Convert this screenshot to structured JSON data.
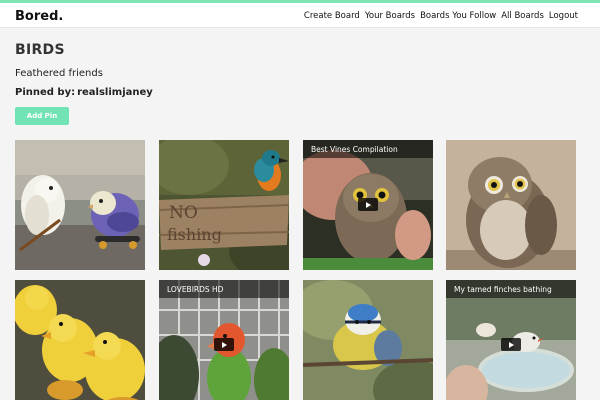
{
  "header": {
    "brand": "Bored.",
    "nav": [
      "Create Board",
      "Your Boards",
      "Boards You Follow",
      "All Boards",
      "Logout"
    ]
  },
  "board": {
    "title": "BIRDS",
    "description": "Feathered friends",
    "pinned_by_label": "Pinned by:",
    "pinned_by_user": "realslimjaney",
    "add_pin_label": "Add Pin"
  },
  "pins": [
    {
      "caption": "",
      "is_video": false,
      "subject": "budgies-on-skateboard"
    },
    {
      "caption": "",
      "is_video": false,
      "subject": "kingfisher-on-sign"
    },
    {
      "caption": "Best Vines Compilation",
      "is_video": true,
      "subject": "owl-in-hand"
    },
    {
      "caption": "",
      "is_video": false,
      "subject": "small-owl"
    },
    {
      "caption": "",
      "is_video": false,
      "subject": "ducklings"
    },
    {
      "caption": "LOVEBIRDS HD",
      "is_video": true,
      "subject": "lovebirds"
    },
    {
      "caption": "",
      "is_video": false,
      "subject": "blue-tit"
    },
    {
      "caption": "My tamed finches bathing",
      "is_video": true,
      "subject": "finches-bathing"
    }
  ]
}
